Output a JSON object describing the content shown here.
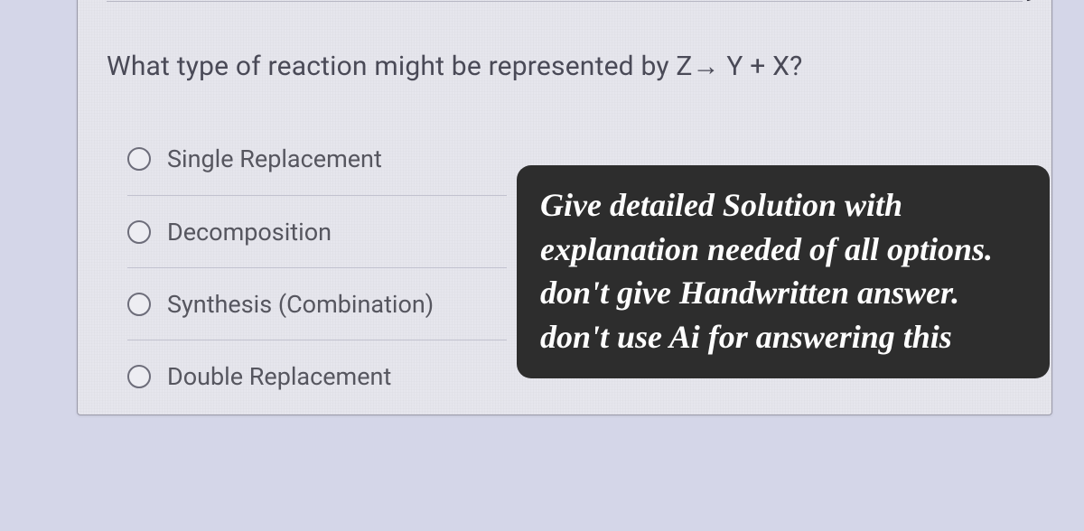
{
  "question": "What type of reaction might be represented by Z→ Y + X?",
  "options": [
    {
      "label": "Single Replacement"
    },
    {
      "label": "Decomposition"
    },
    {
      "label": "Synthesis (Combination)"
    },
    {
      "label": "Double Replacement"
    }
  ],
  "overlay": {
    "text": "Give detailed Solution with explanation needed of all options. don't give Handwritten answer. don't use Ai for answering this"
  }
}
